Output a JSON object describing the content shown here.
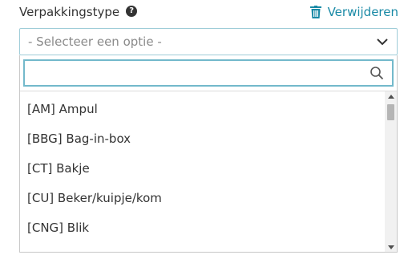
{
  "field": {
    "label": "Verpakkingstype",
    "help_icon": "?",
    "remove_label": "Verwijderen"
  },
  "select": {
    "placeholder": "- Selecteer een optie -"
  },
  "search": {
    "value": "",
    "placeholder": ""
  },
  "options": [
    "[AM] Ampul",
    "[BBG] Bag-in-box",
    "[CT] Bakje",
    "[CU] Beker/kuipje/kom",
    "[CNG] Blik"
  ],
  "icons": {
    "help": "question-circle-icon",
    "remove": "trash-icon",
    "dropdown": "chevron-down-icon",
    "search": "search-icon"
  },
  "colors": {
    "accent": "#1a8aa6",
    "focus_border": "#73b9cb",
    "text": "#333333",
    "placeholder": "#8a8a8a"
  }
}
